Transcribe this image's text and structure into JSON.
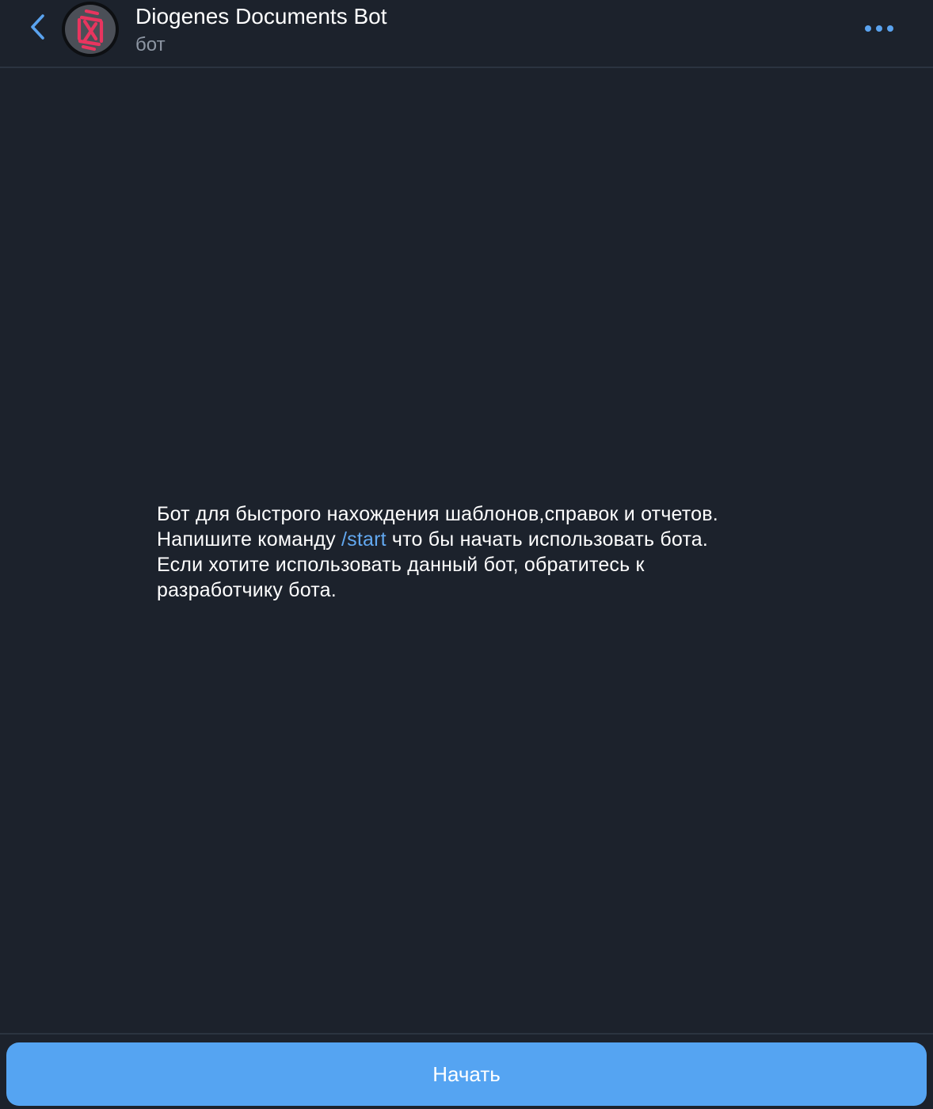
{
  "header": {
    "title": "Diogenes Documents Bot",
    "subtitle": "бот",
    "back_icon": "chevron-left-icon",
    "more_icon": "more-dots-icon",
    "accent_color": "#5aa3ef"
  },
  "chat": {
    "description_lines": [
      "Бот для быстрого нахождения шаблонов,справок и отчетов.",
      "Напишите команду ",
      "/start",
      " что бы начать использовать бота.",
      "Если хотите использовать данный бот, обратитесь к",
      "разработчику бота."
    ],
    "link_color": "#62a8f0",
    "background_color": "#1c222c"
  },
  "footer": {
    "start_label": "Начать",
    "button_color": "#55a4f2"
  }
}
